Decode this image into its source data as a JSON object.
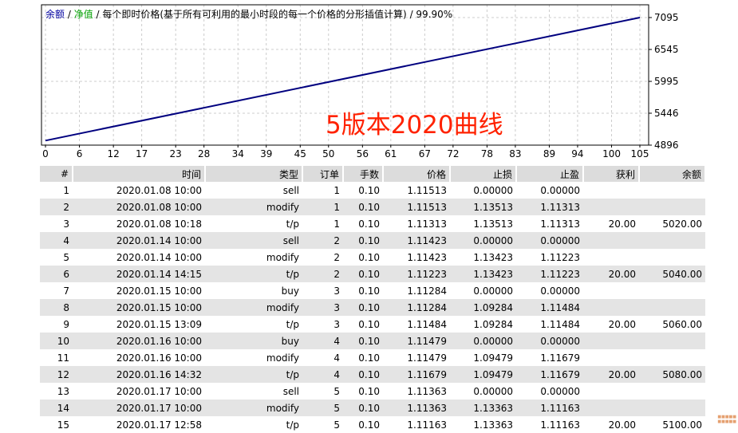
{
  "legend": {
    "balance": "余额",
    "sep1": " / ",
    "equity": "净值",
    "sep2": " / ",
    "description": "每个即时价格(基于所有可利用的最小时段的每一个价格的分形插值计算)",
    "sep3": " / ",
    "quality": "99.90%"
  },
  "overlay_text": "5版本2020曲线",
  "colors": {
    "balance": "#0000a0",
    "equity": "#00a000",
    "line": "#00007f",
    "grid": "#cccccc",
    "overlay": "#ff2200"
  },
  "chart_data": {
    "type": "line",
    "x_ticks": [
      0,
      6,
      12,
      17,
      23,
      28,
      34,
      39,
      45,
      50,
      56,
      61,
      67,
      72,
      78,
      83,
      89,
      94,
      100,
      105
    ],
    "y_ticks": [
      4896,
      5446,
      5995,
      6545,
      7095
    ],
    "xlim": [
      0,
      105
    ],
    "ylim": [
      4896,
      7095
    ],
    "series": [
      {
        "name": "余额",
        "x": [
          0,
          105
        ],
        "y": [
          4975,
          7095
        ]
      }
    ]
  },
  "table": {
    "headers": [
      "#",
      "时间",
      "类型",
      "订单",
      "手数",
      "价格",
      "止损",
      "止盈",
      "获利",
      "余额"
    ],
    "rows": [
      [
        "1",
        "2020.01.08 10:00",
        "sell",
        "1",
        "0.10",
        "1.11513",
        "0.00000",
        "0.00000",
        "",
        ""
      ],
      [
        "2",
        "2020.01.08 10:00",
        "modify",
        "1",
        "0.10",
        "1.11513",
        "1.13513",
        "1.11313",
        "",
        ""
      ],
      [
        "3",
        "2020.01.08 10:18",
        "t/p",
        "1",
        "0.10",
        "1.11313",
        "1.13513",
        "1.11313",
        "20.00",
        "5020.00"
      ],
      [
        "4",
        "2020.01.14 10:00",
        "sell",
        "2",
        "0.10",
        "1.11423",
        "0.00000",
        "0.00000",
        "",
        ""
      ],
      [
        "5",
        "2020.01.14 10:00",
        "modify",
        "2",
        "0.10",
        "1.11423",
        "1.13423",
        "1.11223",
        "",
        ""
      ],
      [
        "6",
        "2020.01.14 14:15",
        "t/p",
        "2",
        "0.10",
        "1.11223",
        "1.13423",
        "1.11223",
        "20.00",
        "5040.00"
      ],
      [
        "7",
        "2020.01.15 10:00",
        "buy",
        "3",
        "0.10",
        "1.11284",
        "0.00000",
        "0.00000",
        "",
        ""
      ],
      [
        "8",
        "2020.01.15 10:00",
        "modify",
        "3",
        "0.10",
        "1.11284",
        "1.09284",
        "1.11484",
        "",
        ""
      ],
      [
        "9",
        "2020.01.15 13:09",
        "t/p",
        "3",
        "0.10",
        "1.11484",
        "1.09284",
        "1.11484",
        "20.00",
        "5060.00"
      ],
      [
        "10",
        "2020.01.16 10:00",
        "buy",
        "4",
        "0.10",
        "1.11479",
        "0.00000",
        "0.00000",
        "",
        ""
      ],
      [
        "11",
        "2020.01.16 10:00",
        "modify",
        "4",
        "0.10",
        "1.11479",
        "1.09479",
        "1.11679",
        "",
        ""
      ],
      [
        "12",
        "2020.01.16 14:32",
        "t/p",
        "4",
        "0.10",
        "1.11679",
        "1.09479",
        "1.11679",
        "20.00",
        "5080.00"
      ],
      [
        "13",
        "2020.01.17 10:00",
        "sell",
        "5",
        "0.10",
        "1.11363",
        "0.00000",
        "0.00000",
        "",
        ""
      ],
      [
        "14",
        "2020.01.17 10:00",
        "modify",
        "5",
        "0.10",
        "1.11363",
        "1.13363",
        "1.11163",
        "",
        ""
      ],
      [
        "15",
        "2020.01.17 12:58",
        "t/p",
        "5",
        "0.10",
        "1.11163",
        "1.13363",
        "1.11163",
        "20.00",
        "5100.00"
      ]
    ]
  }
}
